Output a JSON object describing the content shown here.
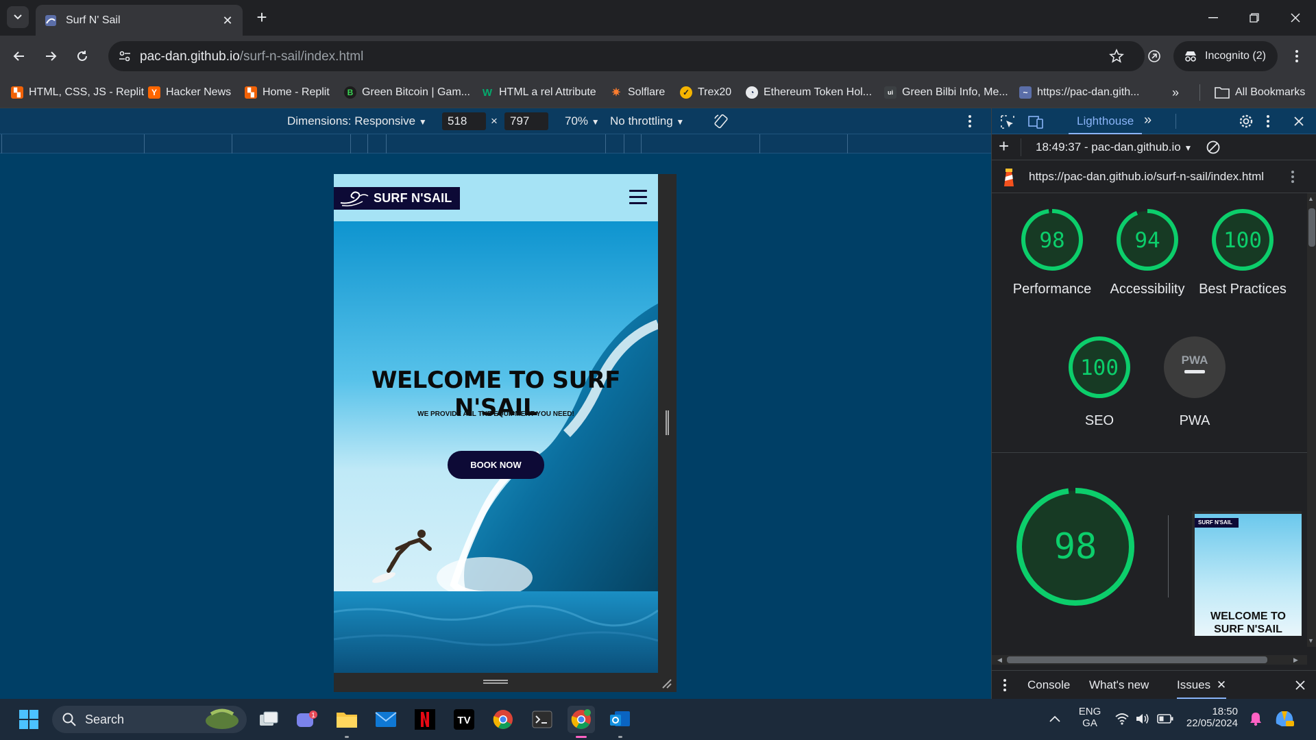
{
  "browser": {
    "tab_title": "Surf N' Sail",
    "url_host": "pac-dan.github.io",
    "url_path": "/surf-n-sail/index.html",
    "incognito_label": "Incognito (2)"
  },
  "bookmarks": {
    "items": [
      {
        "label": "HTML, CSS, JS - Replit",
        "color": "#f26207"
      },
      {
        "label": "Hacker News",
        "color": "#ff6600"
      },
      {
        "label": "Home - Replit",
        "color": "#f26207"
      },
      {
        "label": "Green Bitcoin | Gam...",
        "color": "#1c1c1c"
      },
      {
        "label": "HTML a rel Attribute",
        "color": "#04aa6d"
      },
      {
        "label": "Solflare",
        "color": "#fc7d2f"
      },
      {
        "label": "Trex20",
        "color": "#f5b400"
      },
      {
        "label": "Ethereum Token Hol...",
        "color": "#5f6368"
      },
      {
        "label": "Green Bilbi Info, Me...",
        "color": "#3c4043"
      },
      {
        "label": "https://pac-dan.gith...",
        "color": "#5f6368"
      }
    ],
    "all_bookmarks": "All Bookmarks"
  },
  "device_toolbar": {
    "dimensions": "Dimensions: Responsive",
    "width": "518",
    "times": "×",
    "height": "797",
    "zoom": "70%",
    "throttling": "No throttling"
  },
  "site": {
    "logo_text": "SURF N'SAIL",
    "headline": "WELCOME TO SURF N'SAIL",
    "subheadline": "WE PROVIDE ALL THE EQUIPMENT YOU NEED!",
    "cta": "BOOK NOW"
  },
  "devtools": {
    "panel_tab": "Lighthouse",
    "report_time": "18:49:37 - pac-dan.github.io",
    "report_url": "https://pac-dan.github.io/surf-n-sail/index.html",
    "scores": [
      {
        "label": "Performance",
        "value": "98",
        "fraction": 0.98
      },
      {
        "label": "Accessibility",
        "value": "94",
        "fraction": 0.94
      },
      {
        "label": "Best Practices",
        "value": "100",
        "fraction": 1.0
      },
      {
        "label": "SEO",
        "value": "100",
        "fraction": 1.0
      }
    ],
    "pwa_label": "PWA",
    "pwa_badge": "PWA",
    "big_score": {
      "value": "98",
      "fraction": 0.98
    },
    "thumb_logo": "SURF N'SAIL",
    "thumb_headline": "WELCOME TO SURF N'SAIL",
    "drawer_tabs": [
      "Console",
      "What's new",
      "Issues"
    ],
    "accent_green": "#0cce6b"
  },
  "taskbar": {
    "search_placeholder": "Search",
    "lang": "ENG",
    "lang_sub": "GA",
    "time": "18:50",
    "date": "22/05/2024",
    "notification_count": "1"
  }
}
